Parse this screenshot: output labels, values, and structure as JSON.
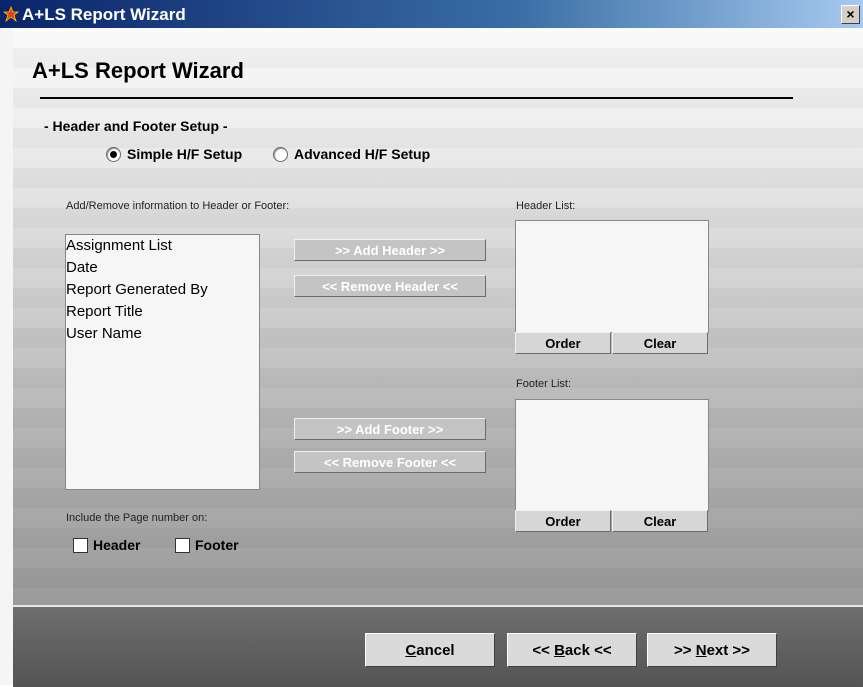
{
  "window": {
    "title": "A+LS Report Wizard",
    "close_glyph": "×"
  },
  "page": {
    "title": "A+LS Report Wizard",
    "section": "- Header and Footer Setup -"
  },
  "setup_mode": {
    "simple": "Simple H/F Setup",
    "advanced": "Advanced H/F Setup",
    "selected": "simple"
  },
  "available": {
    "label": "Add/Remove information to Header or Footer:",
    "items": [
      "Assignment List",
      "Date",
      "Report Generated By",
      "Report Title",
      "User Name"
    ]
  },
  "header_list": {
    "label": "Header List:",
    "order": "Order",
    "clear": "Clear"
  },
  "footer_list": {
    "label": "Footer List:",
    "order": "Order",
    "clear": "Clear"
  },
  "buttons": {
    "add_header": ">> Add Header >>",
    "remove_header": "<< Remove Header <<",
    "add_footer": ">> Add Footer >>",
    "remove_footer": "<< Remove Footer <<"
  },
  "page_number": {
    "label": "Include the Page number on:",
    "header": "Header",
    "footer": "Footer"
  },
  "nav": {
    "cancel_mnemonic": "C",
    "cancel_rest": "ancel",
    "back_pre": "<< ",
    "back_mnemonic": "B",
    "back_rest": "ack <<",
    "next_pre": ">> ",
    "next_mnemonic": "N",
    "next_rest": "ext >>"
  }
}
